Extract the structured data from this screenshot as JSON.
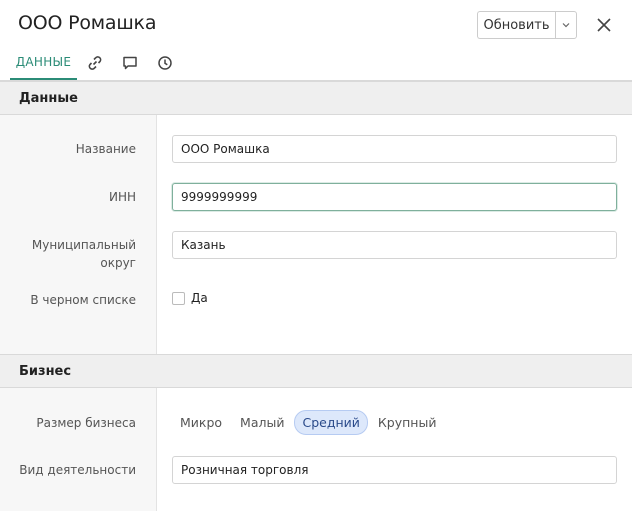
{
  "header": {
    "title": "ООО Ромашка",
    "refresh_label": "Обновить"
  },
  "tabs": [
    {
      "label": "ДАННЫЕ",
      "active": true
    },
    {
      "icon": "link-icon"
    },
    {
      "icon": "comment-icon"
    },
    {
      "icon": "history-icon"
    }
  ],
  "sections": {
    "data": {
      "title": "Данные",
      "fields": {
        "name": {
          "label": "Название",
          "value": "ООО Ромашка"
        },
        "inn": {
          "label": "ИНН",
          "value": "9999999999"
        },
        "district": {
          "label": "Муниципальный округ",
          "value": "Казань"
        },
        "blacklist": {
          "label": "В черном списке",
          "option": "Да",
          "checked": false
        }
      }
    },
    "business": {
      "title": "Бизнес",
      "size": {
        "label": "Размер бизнеса",
        "options": [
          "Микро",
          "Малый",
          "Средний",
          "Крупный"
        ],
        "selected": "Средний"
      },
      "activity": {
        "label": "Вид деятельности",
        "value": "Розничная торговля"
      }
    }
  },
  "colors": {
    "accent": "#2b8c77",
    "selected_bg": "#dde8fb"
  }
}
